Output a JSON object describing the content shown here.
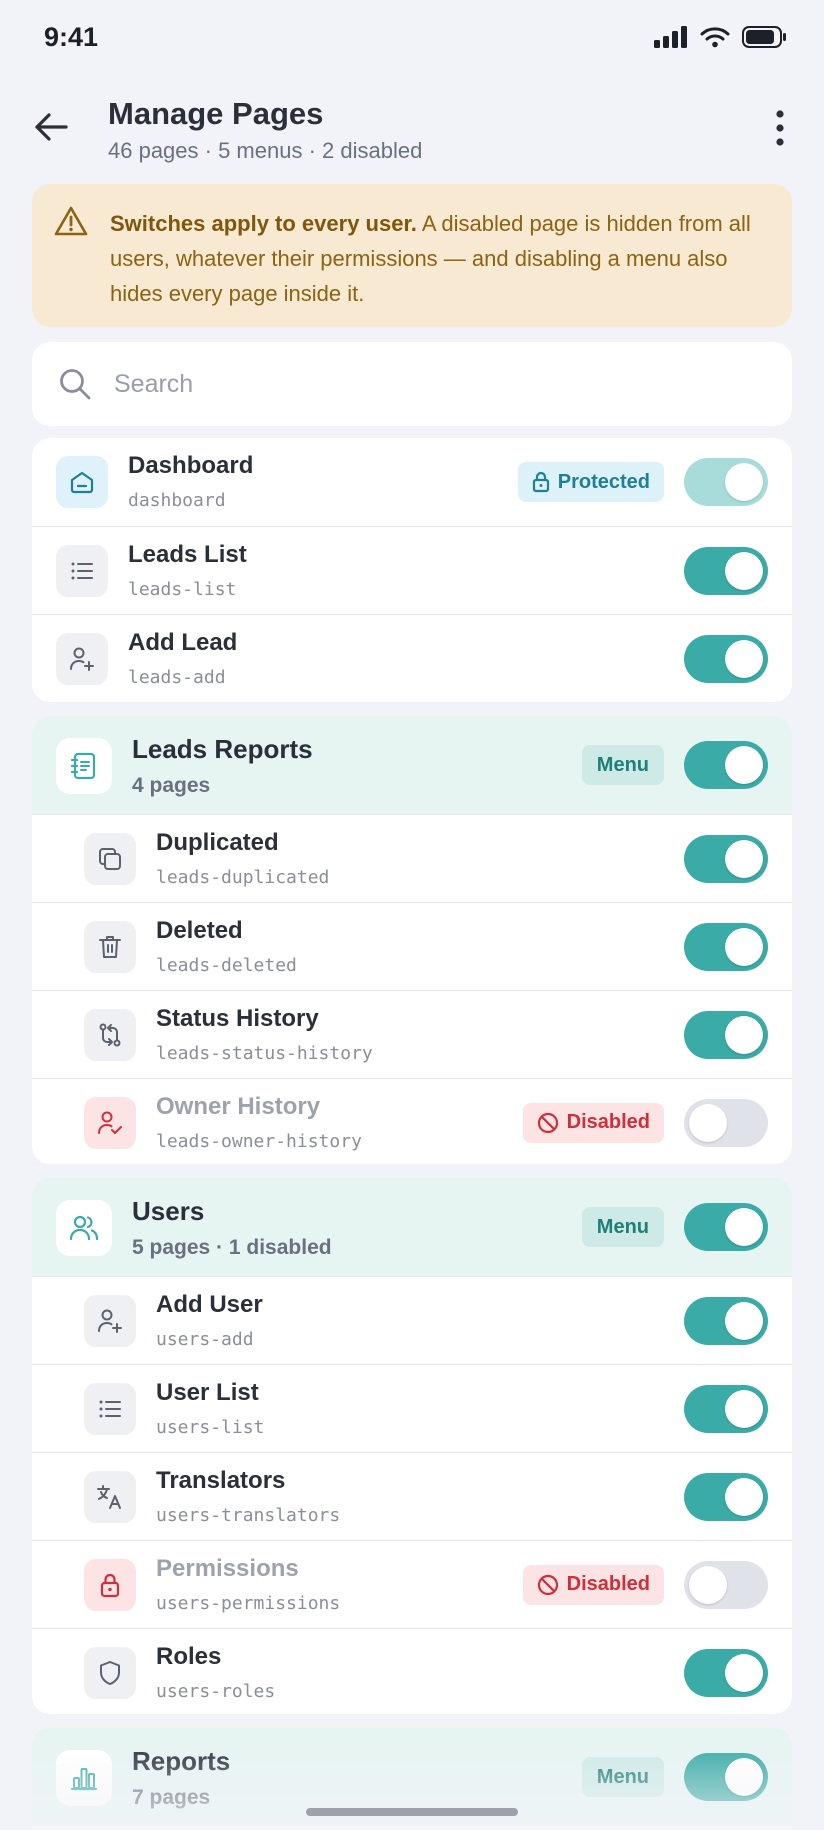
{
  "status_bar": {
    "time": "9:41"
  },
  "header": {
    "title": "Manage Pages",
    "subtitle": "46 pages · 5 menus · 2 disabled"
  },
  "warning": {
    "bold": "Switches apply to every user.",
    "text": " A disabled page is hidden from all users, whatever their permissions — and disabling a menu also hides every page inside it."
  },
  "search": {
    "placeholder": "Search"
  },
  "badges": {
    "protected": "Protected",
    "disabled": "Disabled",
    "menu": "Menu"
  },
  "top_pages": [
    {
      "name": "Dashboard",
      "slug": "dashboard",
      "icon": "home-icon",
      "enabled": true,
      "protected": true
    },
    {
      "name": "Leads List",
      "slug": "leads-list",
      "icon": "list-icon",
      "enabled": true
    },
    {
      "name": "Add Lead",
      "slug": "leads-add",
      "icon": "user-plus-icon",
      "enabled": true
    }
  ],
  "menus": [
    {
      "name": "Leads Reports",
      "count": "4 pages",
      "icon": "address-book-icon",
      "enabled": true,
      "pages": [
        {
          "name": "Duplicated",
          "slug": "leads-duplicated",
          "icon": "copy-icon",
          "enabled": true
        },
        {
          "name": "Deleted",
          "slug": "leads-deleted",
          "icon": "trash-icon",
          "enabled": true
        },
        {
          "name": "Status History",
          "slug": "leads-status-history",
          "icon": "swap-icon",
          "enabled": true
        },
        {
          "name": "Owner History",
          "slug": "leads-owner-history",
          "icon": "user-check-icon",
          "enabled": false
        }
      ]
    },
    {
      "name": "Users",
      "count": "5 pages · 1 disabled",
      "icon": "users-icon",
      "enabled": true,
      "pages": [
        {
          "name": "Add User",
          "slug": "users-add",
          "icon": "user-plus-icon",
          "enabled": true
        },
        {
          "name": "User List",
          "slug": "users-list",
          "icon": "list-icon",
          "enabled": true
        },
        {
          "name": "Translators",
          "slug": "users-translators",
          "icon": "translate-icon",
          "enabled": true
        },
        {
          "name": "Permissions",
          "slug": "users-permissions",
          "icon": "lock-icon",
          "enabled": false
        },
        {
          "name": "Roles",
          "slug": "users-roles",
          "icon": "shield-icon",
          "enabled": true
        }
      ]
    },
    {
      "name": "Reports",
      "count": "7 pages",
      "icon": "bar-chart-icon",
      "enabled": true,
      "pages": []
    }
  ],
  "colors": {
    "accent": "#3aaba6",
    "danger": "#d02f3a",
    "warning_bg": "#f8ead2",
    "warning_text": "#8d6212"
  }
}
